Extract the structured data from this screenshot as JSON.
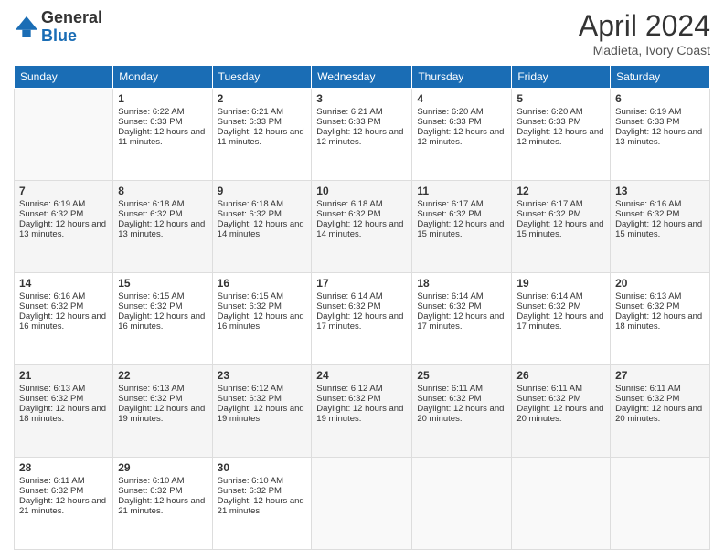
{
  "header": {
    "logo_general": "General",
    "logo_blue": "Blue",
    "month_title": "April 2024",
    "location": "Madieta, Ivory Coast"
  },
  "weekdays": [
    "Sunday",
    "Monday",
    "Tuesday",
    "Wednesday",
    "Thursday",
    "Friday",
    "Saturday"
  ],
  "weeks": [
    [
      {
        "day": "",
        "sunrise": "",
        "sunset": "",
        "daylight": ""
      },
      {
        "day": "1",
        "sunrise": "Sunrise: 6:22 AM",
        "sunset": "Sunset: 6:33 PM",
        "daylight": "Daylight: 12 hours and 11 minutes."
      },
      {
        "day": "2",
        "sunrise": "Sunrise: 6:21 AM",
        "sunset": "Sunset: 6:33 PM",
        "daylight": "Daylight: 12 hours and 11 minutes."
      },
      {
        "day": "3",
        "sunrise": "Sunrise: 6:21 AM",
        "sunset": "Sunset: 6:33 PM",
        "daylight": "Daylight: 12 hours and 12 minutes."
      },
      {
        "day": "4",
        "sunrise": "Sunrise: 6:20 AM",
        "sunset": "Sunset: 6:33 PM",
        "daylight": "Daylight: 12 hours and 12 minutes."
      },
      {
        "day": "5",
        "sunrise": "Sunrise: 6:20 AM",
        "sunset": "Sunset: 6:33 PM",
        "daylight": "Daylight: 12 hours and 12 minutes."
      },
      {
        "day": "6",
        "sunrise": "Sunrise: 6:19 AM",
        "sunset": "Sunset: 6:33 PM",
        "daylight": "Daylight: 12 hours and 13 minutes."
      }
    ],
    [
      {
        "day": "7",
        "sunrise": "Sunrise: 6:19 AM",
        "sunset": "Sunset: 6:32 PM",
        "daylight": "Daylight: 12 hours and 13 minutes."
      },
      {
        "day": "8",
        "sunrise": "Sunrise: 6:18 AM",
        "sunset": "Sunset: 6:32 PM",
        "daylight": "Daylight: 12 hours and 13 minutes."
      },
      {
        "day": "9",
        "sunrise": "Sunrise: 6:18 AM",
        "sunset": "Sunset: 6:32 PM",
        "daylight": "Daylight: 12 hours and 14 minutes."
      },
      {
        "day": "10",
        "sunrise": "Sunrise: 6:18 AM",
        "sunset": "Sunset: 6:32 PM",
        "daylight": "Daylight: 12 hours and 14 minutes."
      },
      {
        "day": "11",
        "sunrise": "Sunrise: 6:17 AM",
        "sunset": "Sunset: 6:32 PM",
        "daylight": "Daylight: 12 hours and 15 minutes."
      },
      {
        "day": "12",
        "sunrise": "Sunrise: 6:17 AM",
        "sunset": "Sunset: 6:32 PM",
        "daylight": "Daylight: 12 hours and 15 minutes."
      },
      {
        "day": "13",
        "sunrise": "Sunrise: 6:16 AM",
        "sunset": "Sunset: 6:32 PM",
        "daylight": "Daylight: 12 hours and 15 minutes."
      }
    ],
    [
      {
        "day": "14",
        "sunrise": "Sunrise: 6:16 AM",
        "sunset": "Sunset: 6:32 PM",
        "daylight": "Daylight: 12 hours and 16 minutes."
      },
      {
        "day": "15",
        "sunrise": "Sunrise: 6:15 AM",
        "sunset": "Sunset: 6:32 PM",
        "daylight": "Daylight: 12 hours and 16 minutes."
      },
      {
        "day": "16",
        "sunrise": "Sunrise: 6:15 AM",
        "sunset": "Sunset: 6:32 PM",
        "daylight": "Daylight: 12 hours and 16 minutes."
      },
      {
        "day": "17",
        "sunrise": "Sunrise: 6:14 AM",
        "sunset": "Sunset: 6:32 PM",
        "daylight": "Daylight: 12 hours and 17 minutes."
      },
      {
        "day": "18",
        "sunrise": "Sunrise: 6:14 AM",
        "sunset": "Sunset: 6:32 PM",
        "daylight": "Daylight: 12 hours and 17 minutes."
      },
      {
        "day": "19",
        "sunrise": "Sunrise: 6:14 AM",
        "sunset": "Sunset: 6:32 PM",
        "daylight": "Daylight: 12 hours and 17 minutes."
      },
      {
        "day": "20",
        "sunrise": "Sunrise: 6:13 AM",
        "sunset": "Sunset: 6:32 PM",
        "daylight": "Daylight: 12 hours and 18 minutes."
      }
    ],
    [
      {
        "day": "21",
        "sunrise": "Sunrise: 6:13 AM",
        "sunset": "Sunset: 6:32 PM",
        "daylight": "Daylight: 12 hours and 18 minutes."
      },
      {
        "day": "22",
        "sunrise": "Sunrise: 6:13 AM",
        "sunset": "Sunset: 6:32 PM",
        "daylight": "Daylight: 12 hours and 19 minutes."
      },
      {
        "day": "23",
        "sunrise": "Sunrise: 6:12 AM",
        "sunset": "Sunset: 6:32 PM",
        "daylight": "Daylight: 12 hours and 19 minutes."
      },
      {
        "day": "24",
        "sunrise": "Sunrise: 6:12 AM",
        "sunset": "Sunset: 6:32 PM",
        "daylight": "Daylight: 12 hours and 19 minutes."
      },
      {
        "day": "25",
        "sunrise": "Sunrise: 6:11 AM",
        "sunset": "Sunset: 6:32 PM",
        "daylight": "Daylight: 12 hours and 20 minutes."
      },
      {
        "day": "26",
        "sunrise": "Sunrise: 6:11 AM",
        "sunset": "Sunset: 6:32 PM",
        "daylight": "Daylight: 12 hours and 20 minutes."
      },
      {
        "day": "27",
        "sunrise": "Sunrise: 6:11 AM",
        "sunset": "Sunset: 6:32 PM",
        "daylight": "Daylight: 12 hours and 20 minutes."
      }
    ],
    [
      {
        "day": "28",
        "sunrise": "Sunrise: 6:11 AM",
        "sunset": "Sunset: 6:32 PM",
        "daylight": "Daylight: 12 hours and 21 minutes."
      },
      {
        "day": "29",
        "sunrise": "Sunrise: 6:10 AM",
        "sunset": "Sunset: 6:32 PM",
        "daylight": "Daylight: 12 hours and 21 minutes."
      },
      {
        "day": "30",
        "sunrise": "Sunrise: 6:10 AM",
        "sunset": "Sunset: 6:32 PM",
        "daylight": "Daylight: 12 hours and 21 minutes."
      },
      {
        "day": "",
        "sunrise": "",
        "sunset": "",
        "daylight": ""
      },
      {
        "day": "",
        "sunrise": "",
        "sunset": "",
        "daylight": ""
      },
      {
        "day": "",
        "sunrise": "",
        "sunset": "",
        "daylight": ""
      },
      {
        "day": "",
        "sunrise": "",
        "sunset": "",
        "daylight": ""
      }
    ]
  ]
}
